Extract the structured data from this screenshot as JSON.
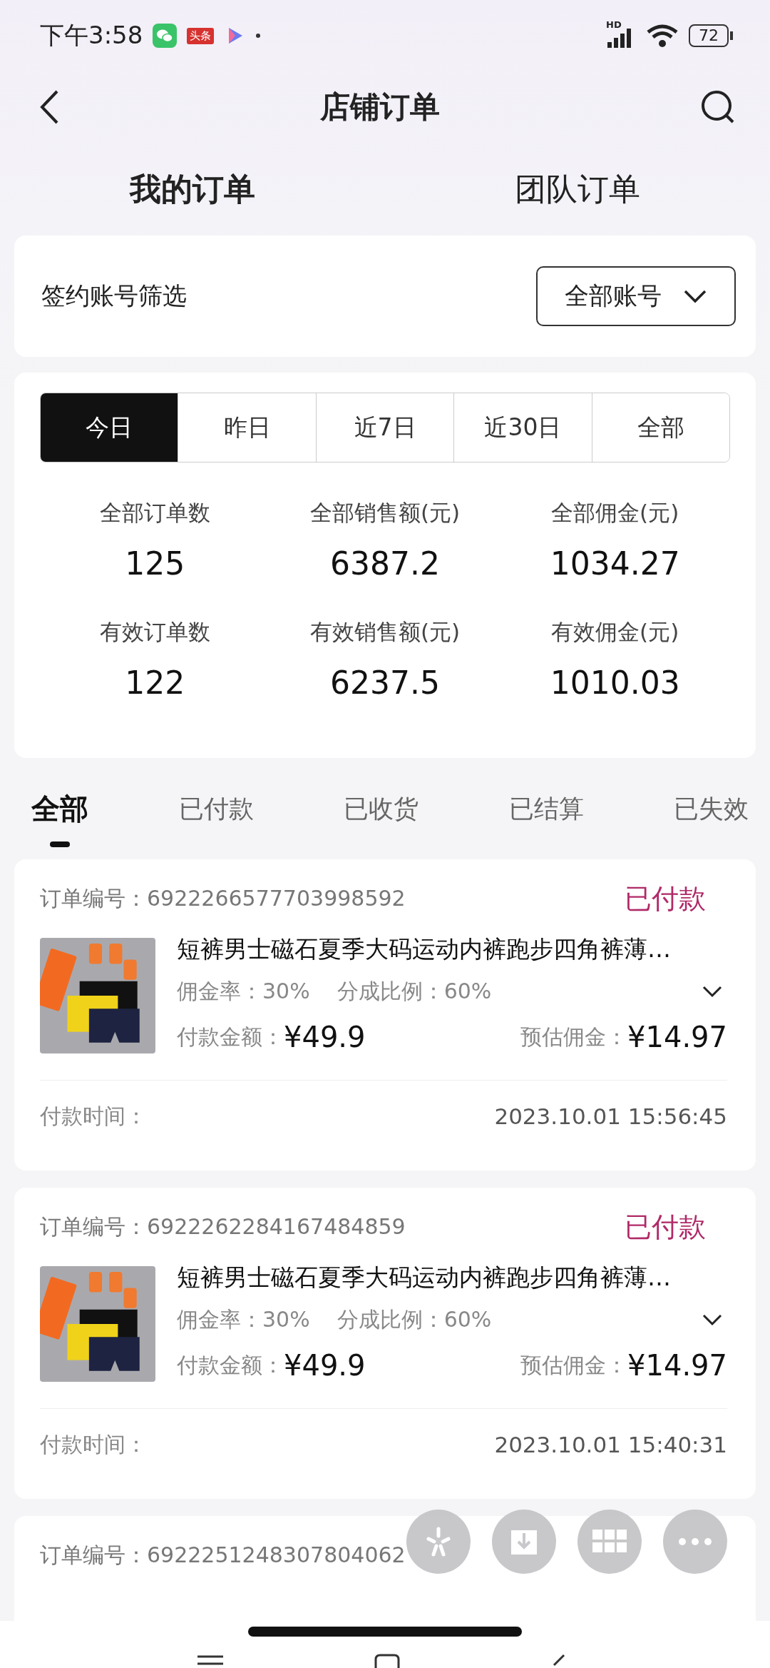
{
  "status_bar": {
    "time": "下午3:58",
    "news_badge": "头条",
    "network": "HD",
    "battery": "72"
  },
  "header": {
    "title": "店铺订单"
  },
  "scope_tabs": [
    {
      "label": "我的订单",
      "selected": true
    },
    {
      "label": "团队订单",
      "selected": false
    }
  ],
  "account_filter": {
    "label": "签约账号筛选",
    "value": "全部账号"
  },
  "period_tabs": [
    {
      "label": "今日",
      "selected": true
    },
    {
      "label": "昨日",
      "selected": false
    },
    {
      "label": "近7日",
      "selected": false
    },
    {
      "label": "近30日",
      "selected": false
    },
    {
      "label": "全部",
      "selected": false
    }
  ],
  "stats": [
    {
      "label": "全部订单数",
      "value": "125"
    },
    {
      "label": "全部销售额(元)",
      "value": "6387.2"
    },
    {
      "label": "全部佣金(元)",
      "value": "1034.27"
    },
    {
      "label": "有效订单数",
      "value": "122"
    },
    {
      "label": "有效销售额(元)",
      "value": "6237.5"
    },
    {
      "label": "有效佣金(元)",
      "value": "1010.03"
    }
  ],
  "status_tabs": [
    {
      "label": "全部",
      "selected": true
    },
    {
      "label": "已付款",
      "selected": false
    },
    {
      "label": "已收货",
      "selected": false
    },
    {
      "label": "已结算",
      "selected": false
    },
    {
      "label": "已失效",
      "selected": false
    }
  ],
  "orders": [
    {
      "order_no": "订单编号：6922266577703998592",
      "status": "已付款",
      "product": {
        "kind": "picture",
        "title": "短裤男士磁石夏季大码运动内裤跑步四角裤薄…",
        "rate": "佣金率：30%",
        "share": "分成比例：60%",
        "paid_label": "付款金额：",
        "paid": "¥49.9",
        "est_label": "预估佣金：",
        "est": "¥14.97"
      },
      "time_label": "付款时间：",
      "time": "2023.10.01 15:56:45"
    },
    {
      "order_no": "订单编号：6922262284167484859",
      "status": "已付款",
      "product": {
        "kind": "picture",
        "title": "短裤男士磁石夏季大码运动内裤跑步四角裤薄…",
        "rate": "佣金率：30%",
        "share": "分成比例：60%",
        "paid_label": "付款金额：",
        "paid": "¥49.9",
        "est_label": "预估佣金：",
        "est": "¥14.97"
      },
      "time_label": "付款时间：",
      "time": "2023.10.01 15:40:31"
    },
    {
      "order_no": "订单编号：6922251248307804062"
    }
  ]
}
